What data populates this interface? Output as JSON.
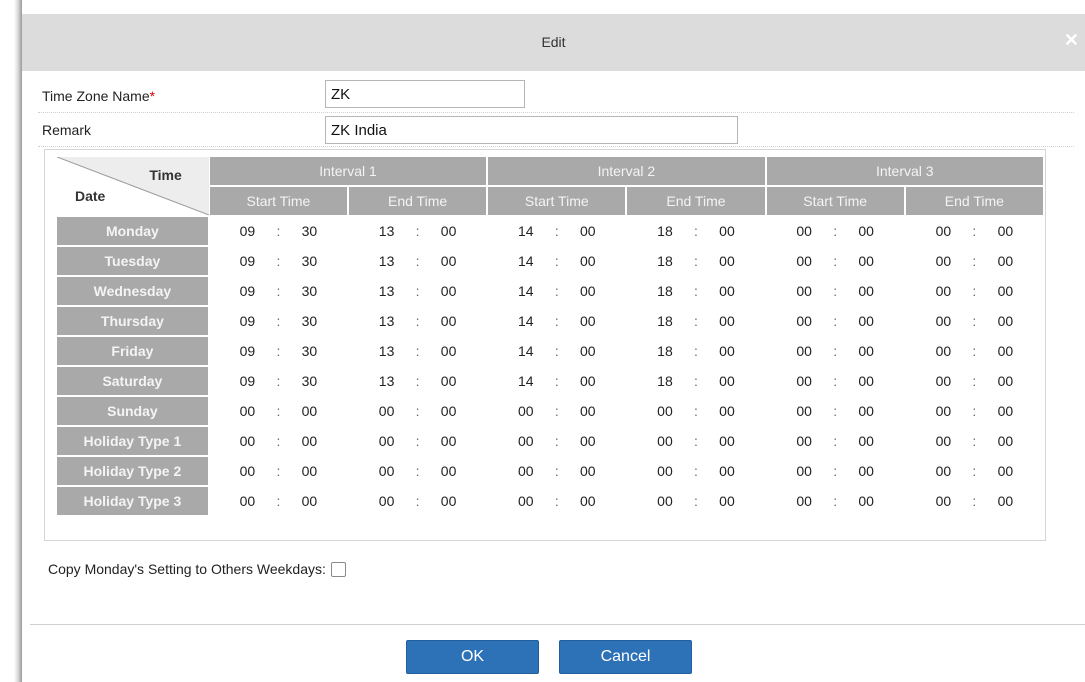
{
  "dialog": {
    "title": "Edit",
    "close_icon": "close-icon"
  },
  "form": {
    "tz_name_label": "Time Zone Name",
    "required_mark": "*",
    "tz_name_value": "ZK",
    "remark_label": "Remark",
    "remark_value": "ZK India"
  },
  "grid": {
    "corner_time": "Time",
    "corner_date": "Date",
    "intervals": [
      "Interval 1",
      "Interval 2",
      "Interval 3"
    ],
    "start_label": "Start Time",
    "end_label": "End Time",
    "rows": [
      {
        "day": "Monday",
        "times": [
          [
            "09",
            "30"
          ],
          [
            "13",
            "00"
          ],
          [
            "14",
            "00"
          ],
          [
            "18",
            "00"
          ],
          [
            "00",
            "00"
          ],
          [
            "00",
            "00"
          ]
        ]
      },
      {
        "day": "Tuesday",
        "times": [
          [
            "09",
            "30"
          ],
          [
            "13",
            "00"
          ],
          [
            "14",
            "00"
          ],
          [
            "18",
            "00"
          ],
          [
            "00",
            "00"
          ],
          [
            "00",
            "00"
          ]
        ]
      },
      {
        "day": "Wednesday",
        "times": [
          [
            "09",
            "30"
          ],
          [
            "13",
            "00"
          ],
          [
            "14",
            "00"
          ],
          [
            "18",
            "00"
          ],
          [
            "00",
            "00"
          ],
          [
            "00",
            "00"
          ]
        ]
      },
      {
        "day": "Thursday",
        "times": [
          [
            "09",
            "30"
          ],
          [
            "13",
            "00"
          ],
          [
            "14",
            "00"
          ],
          [
            "18",
            "00"
          ],
          [
            "00",
            "00"
          ],
          [
            "00",
            "00"
          ]
        ]
      },
      {
        "day": "Friday",
        "times": [
          [
            "09",
            "30"
          ],
          [
            "13",
            "00"
          ],
          [
            "14",
            "00"
          ],
          [
            "18",
            "00"
          ],
          [
            "00",
            "00"
          ],
          [
            "00",
            "00"
          ]
        ]
      },
      {
        "day": "Saturday",
        "times": [
          [
            "09",
            "30"
          ],
          [
            "13",
            "00"
          ],
          [
            "14",
            "00"
          ],
          [
            "18",
            "00"
          ],
          [
            "00",
            "00"
          ],
          [
            "00",
            "00"
          ]
        ]
      },
      {
        "day": "Sunday",
        "times": [
          [
            "00",
            "00"
          ],
          [
            "00",
            "00"
          ],
          [
            "00",
            "00"
          ],
          [
            "00",
            "00"
          ],
          [
            "00",
            "00"
          ],
          [
            "00",
            "00"
          ]
        ]
      },
      {
        "day": "Holiday Type 1",
        "times": [
          [
            "00",
            "00"
          ],
          [
            "00",
            "00"
          ],
          [
            "00",
            "00"
          ],
          [
            "00",
            "00"
          ],
          [
            "00",
            "00"
          ],
          [
            "00",
            "00"
          ]
        ]
      },
      {
        "day": "Holiday Type 2",
        "times": [
          [
            "00",
            "00"
          ],
          [
            "00",
            "00"
          ],
          [
            "00",
            "00"
          ],
          [
            "00",
            "00"
          ],
          [
            "00",
            "00"
          ],
          [
            "00",
            "00"
          ]
        ]
      },
      {
        "day": "Holiday Type 3",
        "times": [
          [
            "00",
            "00"
          ],
          [
            "00",
            "00"
          ],
          [
            "00",
            "00"
          ],
          [
            "00",
            "00"
          ],
          [
            "00",
            "00"
          ],
          [
            "00",
            "00"
          ]
        ]
      }
    ]
  },
  "copy": {
    "label": "Copy Monday's Setting to Others Weekdays:",
    "checked": false
  },
  "buttons": {
    "ok": "OK",
    "cancel": "Cancel"
  },
  "colors": {
    "header_gray": "#a9a9a9",
    "button_blue": "#2d71b6",
    "required_red": "#d00000"
  }
}
